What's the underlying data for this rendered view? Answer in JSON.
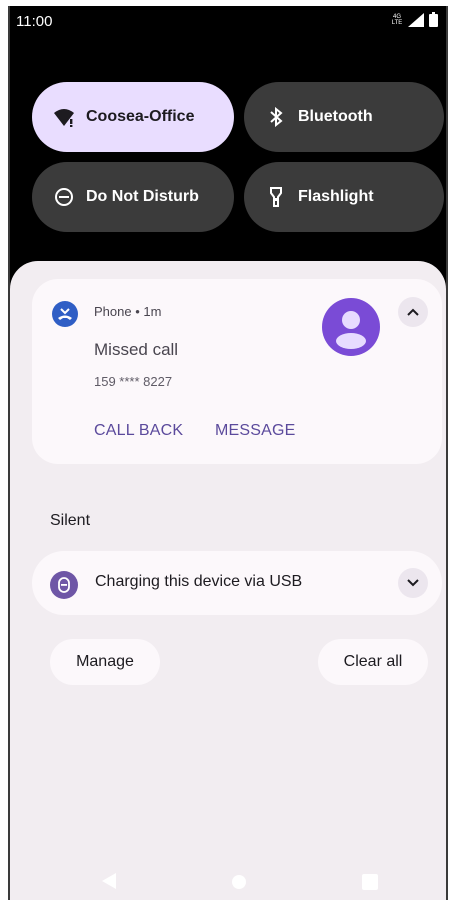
{
  "status_bar": {
    "time": "11:00",
    "network_label": "4G LTE",
    "icons": [
      "network-type-icon",
      "signal-icon",
      "battery-icon"
    ]
  },
  "quick_settings": {
    "tiles": [
      {
        "label": "Coosea-Office",
        "icon": "wifi-icon",
        "active": true
      },
      {
        "label": "Bluetooth",
        "icon": "bluetooth-icon",
        "active": false
      },
      {
        "label": "Do Not Disturb",
        "icon": "do-not-disturb-icon",
        "active": false
      },
      {
        "label": "Flashlight",
        "icon": "flashlight-icon",
        "active": false
      }
    ]
  },
  "notification": {
    "app_name": "Phone",
    "time_ago": "1m",
    "app_line": "Phone • 1m",
    "title": "Missed call",
    "text": "159 **** 8227",
    "actions": [
      "CALL BACK",
      "MESSAGE"
    ],
    "icon": "missed-call-icon",
    "avatar_icon": "person-icon"
  },
  "silent_section": {
    "label": "Silent",
    "item_text": "Charging this device via USB",
    "item_icon": "usb-icon"
  },
  "footer_buttons": {
    "manage": "Manage",
    "clear_all": "Clear all"
  },
  "nav": {
    "buttons": [
      "back-icon",
      "home-icon",
      "recents-icon"
    ]
  },
  "colors": {
    "active_tile": "#e9ddff",
    "inactive_tile": "#3b3b3b",
    "shade_background": "#f2edf1",
    "card_background": "#fcf8fb",
    "accent_text": "#5b4a9c",
    "avatar": "#7a4bd6",
    "phone_icon": "#2f5ec5"
  }
}
